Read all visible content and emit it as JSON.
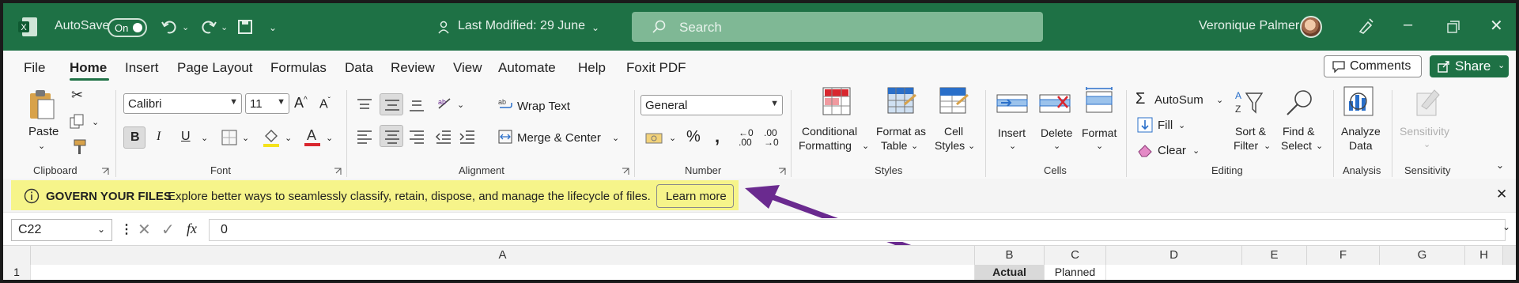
{
  "title_bar": {
    "autosave_label": "AutoSave",
    "autosave_state": "On",
    "last_modified": "Last Modified: 29 June",
    "search_placeholder": "Search",
    "user_name": "Veronique Palmer"
  },
  "menu": {
    "items": [
      "File",
      "Home",
      "Insert",
      "Page Layout",
      "Formulas",
      "Data",
      "Review",
      "View",
      "Automate",
      "Help",
      "Foxit PDF"
    ],
    "active": "Home",
    "comments_label": "Comments",
    "share_label": "Share"
  },
  "ribbon": {
    "clipboard": {
      "paste": "Paste",
      "label": "Clipboard"
    },
    "font": {
      "font_name": "Calibri",
      "font_size": "11",
      "bold": "B",
      "italic": "I",
      "underline": "U",
      "label": "Font"
    },
    "alignment": {
      "wrap_text": "Wrap Text",
      "merge_center": "Merge & Center",
      "label": "Alignment"
    },
    "number": {
      "format": "General",
      "label": "Number"
    },
    "styles": {
      "conditional_line1": "Conditional",
      "conditional_line2": "Formatting",
      "format_table_line1": "Format as",
      "format_table_line2": "Table",
      "cell_styles_line1": "Cell",
      "cell_styles_line2": "Styles",
      "label": "Styles"
    },
    "cells": {
      "insert": "Insert",
      "delete": "Delete",
      "format": "Format",
      "label": "Cells"
    },
    "editing": {
      "autosum": "AutoSum",
      "fill": "Fill",
      "clear": "Clear",
      "sort_line1": "Sort &",
      "sort_line2": "Filter",
      "find_line1": "Find &",
      "find_line2": "Select",
      "label": "Editing"
    },
    "analysis": {
      "analyze_line1": "Analyze",
      "analyze_line2": "Data",
      "label": "Analysis"
    },
    "sensitivity": {
      "button": "Sensitivity",
      "label": "Sensitivity"
    }
  },
  "message_bar": {
    "title": "GOVERN YOUR FILES",
    "body": "Explore better ways to seamlessly classify, retain, dispose, and manage the lifecycle of files.",
    "action": "Learn more",
    "highlight_color": "#f6f48a",
    "arrow_color": "#6a2a8f"
  },
  "formula_bar": {
    "name_box": "C22",
    "fx": "fx",
    "value": "0"
  },
  "sheet": {
    "columns": [
      "A",
      "B",
      "C",
      "D",
      "E",
      "F",
      "G",
      "H"
    ],
    "row1_label": "1",
    "row1": {
      "B": "Actual",
      "C": "Planned"
    }
  },
  "colors": {
    "brand": "#1e7145"
  }
}
